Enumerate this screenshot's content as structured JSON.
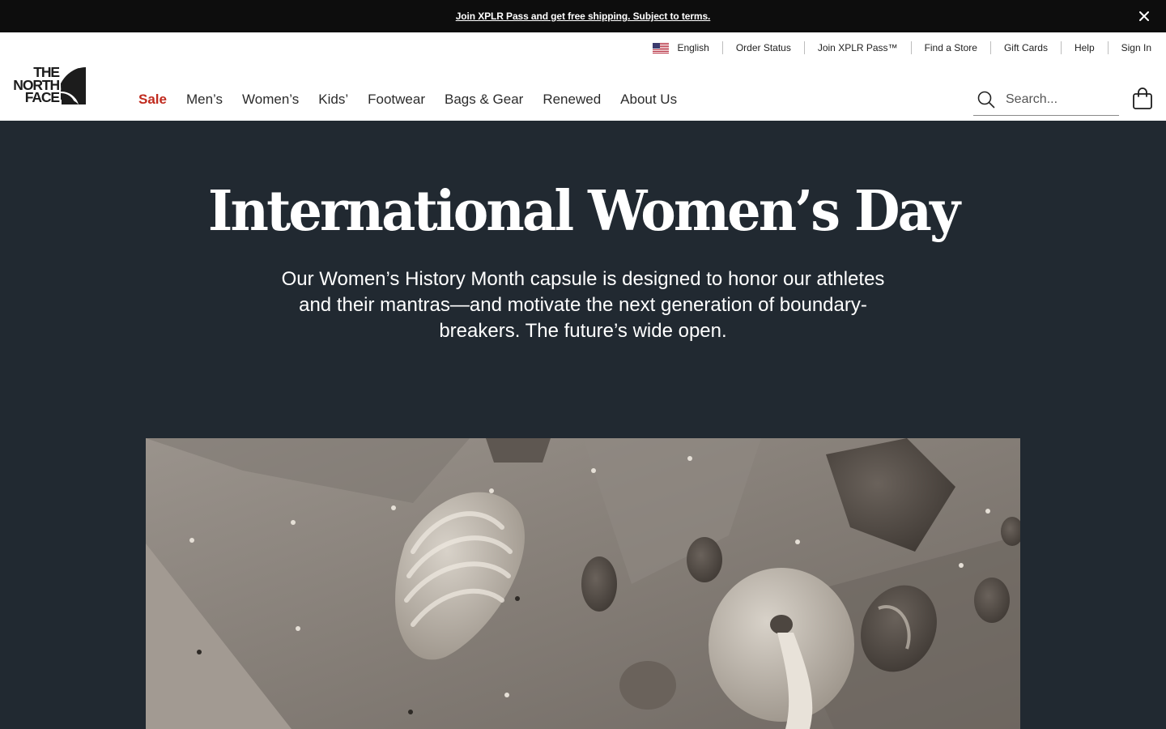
{
  "promo": {
    "text": "Join XPLR Pass and get free shipping. Subject to terms.",
    "close_icon": "close-icon"
  },
  "utility_nav": {
    "language": "English",
    "flag_icon": "us-flag-icon",
    "items": [
      "Order Status",
      "Join XPLR Pass™",
      "Find a Store",
      "Gift Cards",
      "Help",
      "Sign In"
    ]
  },
  "brand": {
    "logo_lines": [
      "THE",
      "NORTH",
      "FACE"
    ]
  },
  "main_nav": {
    "items": [
      "Sale",
      "Men’s",
      "Women’s",
      "Kids’",
      "Footwear",
      "Bags & Gear",
      "Renewed",
      "About Us"
    ],
    "sale_color": "#c02a1e"
  },
  "search": {
    "placeholder": "Search...",
    "icon": "search-icon"
  },
  "cart": {
    "icon": "shopping-bag-icon"
  },
  "hero": {
    "title": "International Women’s Day",
    "description": "Our Women’s History Month capsule is designed to honor our athletes and their mantras—and motivate the next generation of boundary-breakers. The future’s wide open.",
    "background_color": "#212931"
  },
  "colors": {
    "promo_bg": "#0d0d0d",
    "accent_sale": "#c02a1e",
    "hero_bg": "#212931"
  }
}
